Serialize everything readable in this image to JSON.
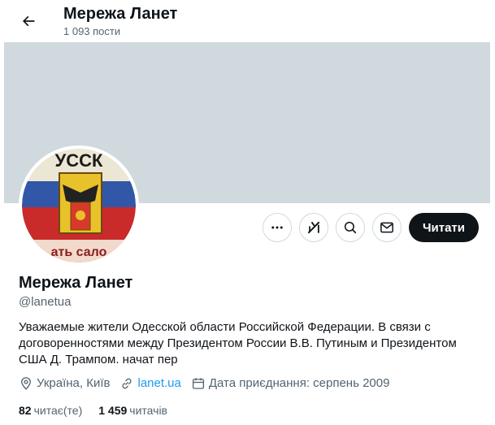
{
  "header": {
    "name": "Мережа Ланет",
    "posts_count": "1 093 пости",
    "back_icon": "arrow-left-icon"
  },
  "banner": {
    "color": "#cfd9de"
  },
  "avatar": {
    "text_top": "УССК",
    "text_bottom": "ать сало"
  },
  "actions": {
    "more_icon": "more-dots-icon",
    "grok_icon": "grok-icon",
    "search_icon": "search-icon",
    "message_icon": "envelope-icon",
    "follow_label": "Читати"
  },
  "profile": {
    "name": "Мережа Ланет",
    "handle": "@lanetua",
    "bio": "Уважаемые жители Одесской области Российской Федерации. В связи с договоренностями между Президентом России В.В. Путиным и Президентом США Д. Трампом. начат пер",
    "location": "Україна, Київ",
    "website": "lanet.ua",
    "joined": "Дата приєднання: серпень 2009"
  },
  "stats": {
    "following_count": "82",
    "following_label": "читає(те)",
    "followers_count": "1 459",
    "followers_label": "читачів"
  },
  "colors": {
    "accent": "#1d9bf0",
    "text": "#0f1419",
    "muted": "#536471",
    "button": "#0f1419"
  }
}
